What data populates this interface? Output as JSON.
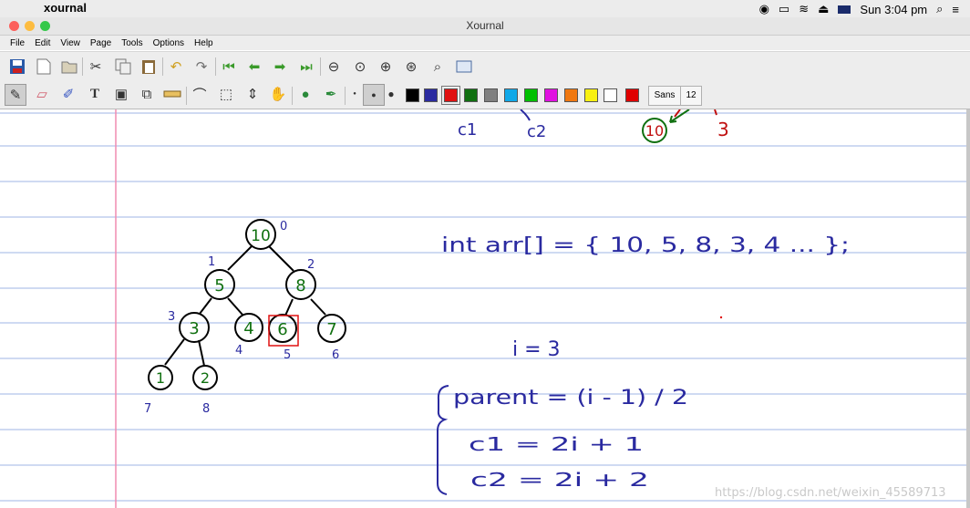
{
  "mac_menubar": {
    "app_name": "xournal",
    "clock": "Sun 3:04 pm"
  },
  "window": {
    "title": "Xournal"
  },
  "menus": [
    "File",
    "Edit",
    "View",
    "Page",
    "Tools",
    "Options",
    "Help"
  ],
  "toolbar_main_icons": [
    "save-icon",
    "new-page-icon",
    "open-icon",
    "cut-icon",
    "copy-icon",
    "paste-icon",
    "undo-icon",
    "redo-icon",
    "first-page-icon",
    "previous-page-icon",
    "next-page-icon",
    "last-page-icon",
    "zoom-out-icon",
    "zoom-page-width-icon",
    "zoom-in-icon",
    "zoom-normal-icon",
    "zoom-set-icon",
    "fullscreen-icon"
  ],
  "toolbar_pen": {
    "font_name": "Sans",
    "font_size": "12",
    "colors": [
      "#000000",
      "#2a2aa0",
      "#e01010",
      "#107010",
      "#808080",
      "#10a8e8",
      "#00c000",
      "#e010e0",
      "#f07810",
      "#f8f010",
      "#ffffff",
      "#e00000"
    ],
    "selected_color": "#e01010"
  },
  "note_top": {
    "c1": "c1",
    "c2": "c2",
    "circled_value": "10",
    "value": "3"
  },
  "tree": {
    "nodes": [
      {
        "value": "10",
        "index": "0"
      },
      {
        "value": "5",
        "index": "1"
      },
      {
        "value": "8",
        "index": "2"
      },
      {
        "value": "3",
        "index": "3"
      },
      {
        "value": "4",
        "index": "4"
      },
      {
        "value": "6",
        "index": "5"
      },
      {
        "value": "7",
        "index": "6"
      },
      {
        "value": "1",
        "index": "7"
      },
      {
        "value": "2",
        "index": "8"
      }
    ],
    "highlighted_node": "6"
  },
  "notes": {
    "array_line": "int arr[] = { 10, 5, 8, 3, 4 ... };",
    "i_line": "i = 3",
    "parent_line": "parent = (i - 1) / 2",
    "c1_line": "c1 = 2i + 1",
    "c2_line": "c2 = 2i + 2"
  },
  "watermark": "https://blog.csdn.net/weixin_45589713"
}
